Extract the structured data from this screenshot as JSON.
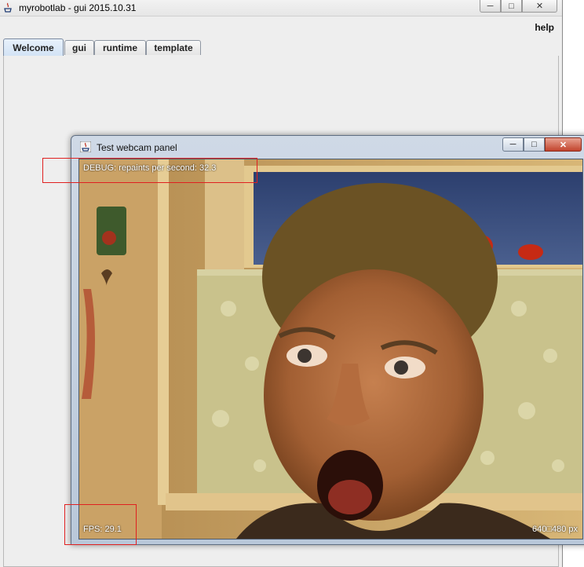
{
  "main_window": {
    "title": "myrobotlab - gui 2015.10.31",
    "menu": {
      "help_label": "help"
    },
    "tabs": [
      {
        "label": "Welcome",
        "active": true
      },
      {
        "label": "gui",
        "active": false
      },
      {
        "label": "runtime",
        "active": false
      },
      {
        "label": "template",
        "active": false
      }
    ]
  },
  "webcam_window": {
    "title": "Test webcam panel",
    "debug_text": "DEBUG: repaints per second: 32.3",
    "fps_text": "FPS: 29.1",
    "resolution_text": "640□480 px"
  },
  "colors": {
    "highlight_box": "#e02020",
    "close_button": "#c2432c",
    "active_tab": "#d3e3f5"
  },
  "icons": {
    "main_window_icon": "java-logo-icon",
    "webcam_window_icon": "java-logo-icon",
    "minimize": "minimize-icon",
    "maximize": "maximize-icon",
    "close": "close-icon"
  }
}
